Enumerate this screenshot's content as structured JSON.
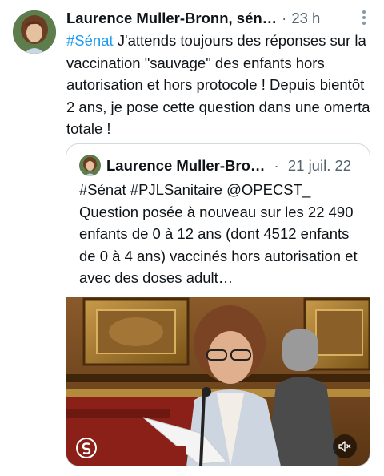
{
  "tweet": {
    "author": "Laurence Muller-Bronn, sén…",
    "separator": "·",
    "time": "23 h",
    "hashtag": "#Sénat",
    "text_after_hashtag": " J'attends toujours des réponses sur la vaccination \"sauvage\" des enfants hors autorisation et hors protocole ! Depuis bientôt 2 ans, je pose cette question dans une omerta totale !"
  },
  "quote": {
    "author": "Laurence Muller-Bro…",
    "separator": "·",
    "date": "21 juil. 22",
    "text": "#Sénat #PJLSanitaire @OPECST_ Question posée à nouveau sur les 22 490 enfants de 0 à 12 ans (dont 4512 enfants de 0 à 4 ans) vaccinés hors autorisation et avec des doses adult…"
  },
  "icons": {
    "more": "more-vertical-icon",
    "mute": "volume-muted-icon",
    "channel_logo": "public-senat-logo"
  },
  "colors": {
    "link": "#1d9bf0",
    "text": "#0f1419",
    "muted": "#536471",
    "border": "#cfd9de"
  }
}
